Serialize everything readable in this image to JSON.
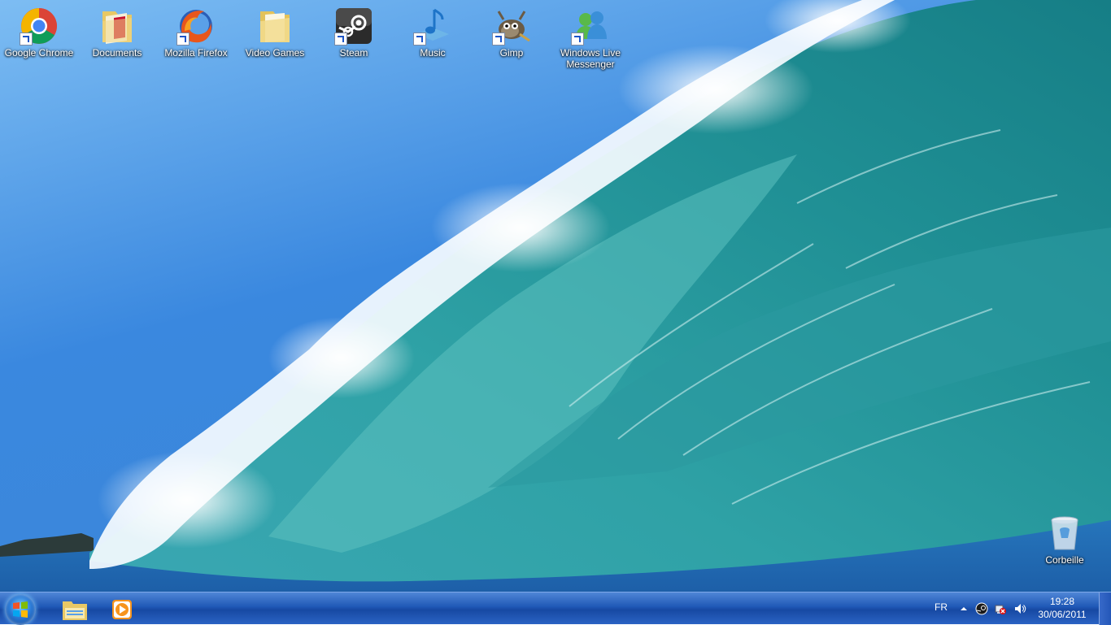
{
  "desktop": {
    "icons": [
      {
        "label": "Google Chrome",
        "icon": "chrome-icon",
        "shortcut": true
      },
      {
        "label": "Documents",
        "icon": "documents-folder-icon",
        "shortcut": false
      },
      {
        "label": "Mozilla Firefox",
        "icon": "firefox-icon",
        "shortcut": true
      },
      {
        "label": "Video Games",
        "icon": "folder-icon",
        "shortcut": false
      },
      {
        "label": "Steam",
        "icon": "steam-icon",
        "shortcut": true
      },
      {
        "label": "Music",
        "icon": "music-icon",
        "shortcut": true
      },
      {
        "label": "Gimp",
        "icon": "gimp-icon",
        "shortcut": true
      },
      {
        "label": "Windows Live Messenger",
        "icon": "messenger-icon",
        "shortcut": true
      }
    ],
    "recycle_bin": {
      "label": "Corbeille",
      "icon": "recycle-bin-icon"
    }
  },
  "taskbar": {
    "start_button": {
      "icon": "windows-start-icon"
    },
    "pinned": [
      {
        "icon": "windows-explorer-icon",
        "name": "Windows Explorer"
      },
      {
        "icon": "media-player-icon",
        "name": "Media Player"
      }
    ],
    "tray": {
      "language": "FR",
      "icons": [
        "show-hidden-icons-arrow-icon",
        "steam-tray-icon",
        "network-alert-icon",
        "volume-icon"
      ],
      "time": "19:28",
      "date": "30/06/2011"
    }
  },
  "colors": {
    "taskbar": "#1f58b6",
    "sky": "#3f8fe3",
    "wave": "#2f9a9e"
  }
}
